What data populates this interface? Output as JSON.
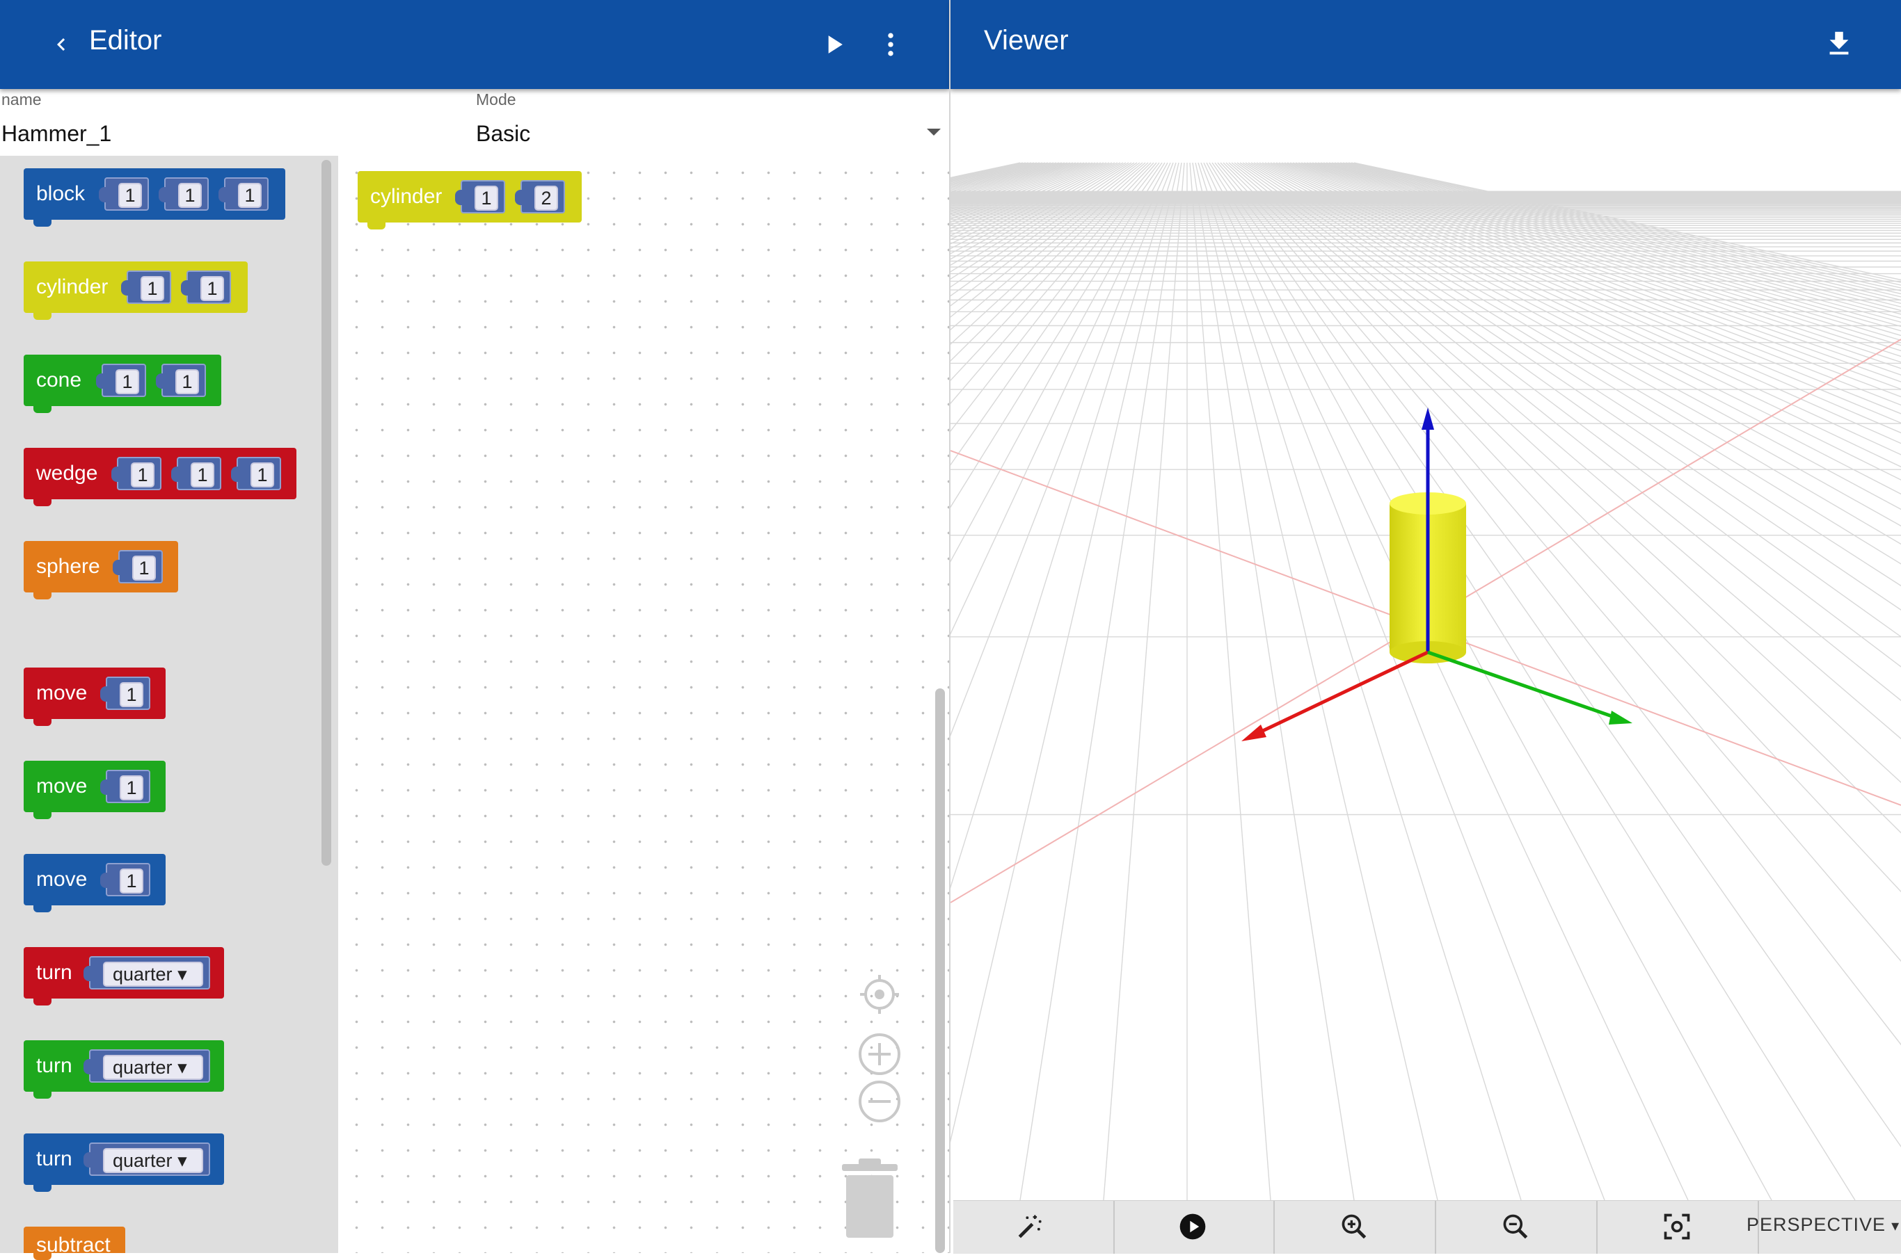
{
  "editor": {
    "title": "Editor",
    "back_icon": "chevron-left-icon",
    "run_icon": "play-icon",
    "menu_icon": "more-vert-icon",
    "name_label": "name",
    "name_value": "Hammer_1",
    "mode_label": "Mode",
    "mode_value": "Basic"
  },
  "viewer": {
    "title": "Viewer",
    "download_icon": "download-icon",
    "camera_mode": "PERSPECTIVE",
    "toolbar_icons": [
      "magic-wand-icon",
      "play-circle-icon",
      "zoom-in-icon",
      "zoom-out-icon",
      "focus-frame-icon"
    ]
  },
  "toolbox": {
    "blocks": [
      {
        "label": "block",
        "color": "#1a5aa8",
        "values": [
          "1",
          "1",
          "1"
        ]
      },
      {
        "label": "cylinder",
        "color": "#d3d318",
        "values": [
          "1",
          "1"
        ]
      },
      {
        "label": "cone",
        "color": "#1ea81e",
        "values": [
          "1",
          "1"
        ]
      },
      {
        "label": "wedge",
        "color": "#c4101d",
        "values": [
          "1",
          "1",
          "1"
        ]
      },
      {
        "label": "sphere",
        "color": "#e37b1a",
        "values": [
          "1"
        ]
      },
      {
        "label": "move",
        "color": "#c4101d",
        "values": [
          "1"
        ]
      },
      {
        "label": "move",
        "color": "#1ea81e",
        "values": [
          "1"
        ]
      },
      {
        "label": "move",
        "color": "#1a5aa8",
        "values": [
          "1"
        ]
      },
      {
        "label": "turn",
        "color": "#c4101d",
        "values": [
          "quarter"
        ]
      },
      {
        "label": "turn",
        "color": "#1ea81e",
        "values": [
          "quarter"
        ]
      },
      {
        "label": "turn",
        "color": "#1a5aa8",
        "values": [
          "quarter"
        ]
      },
      {
        "label": "subtract",
        "color": "#e37b1a",
        "values": []
      }
    ]
  },
  "workspace": {
    "block": {
      "label": "cylinder",
      "color": "#d3d318",
      "values": [
        "1",
        "2"
      ]
    }
  },
  "colors": {
    "appbar": "#0f50a3",
    "x_axis": "#e01818",
    "y_axis": "#12b812",
    "z_axis": "#1010c8",
    "shape": "#f0f030"
  }
}
